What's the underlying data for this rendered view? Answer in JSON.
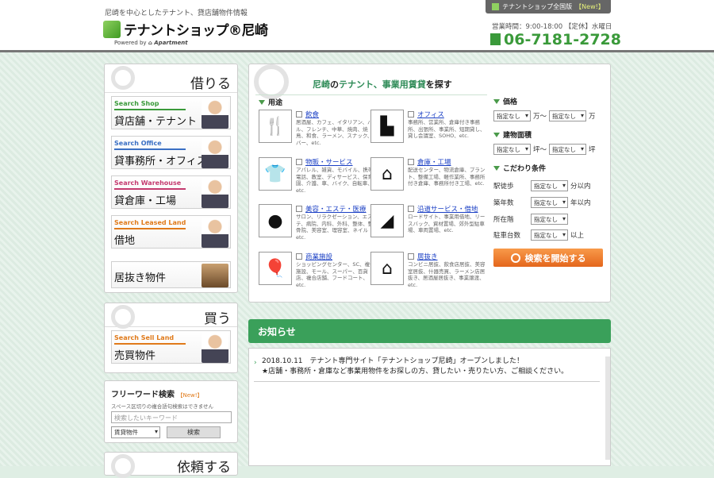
{
  "header": {
    "tagline": "尼崎を中心としたテナント、貸店舗物件情報",
    "logo": "テナントショップ®尼崎",
    "powered": "Powered by",
    "all_stores_label": "テナントショップ全国版",
    "all_stores_badge": "【New!】",
    "hours": "営業時間：9:00-18:00 【定休】水曜日",
    "phone": "06-7181-2728",
    "colors": {
      "green": "#3a9a3a",
      "border": "#777777"
    }
  },
  "rent": {
    "heading": "借りる",
    "items": [
      {
        "en": "Search Shop",
        "jp": "貸店舗・テナント"
      },
      {
        "en": "Search Office",
        "jp": "貸事務所・オフィス"
      },
      {
        "en": "Search Warehouse",
        "jp": "貸倉庫・工場"
      },
      {
        "en": "Search Leased Land",
        "jp": "借地"
      }
    ],
    "extra": "居抜き物件"
  },
  "buy": {
    "heading": "買う",
    "items": [
      {
        "en": "Search Sell Land",
        "jp": "売買物件"
      }
    ]
  },
  "free_word": {
    "title": "フリーワード検索",
    "badge": "【New!】",
    "note": "スペース区切りの複合語句検索はできません",
    "placeholder": "検索したいキーワード",
    "select_value": "賃貸物件",
    "button": "検索"
  },
  "bottom_heading": "依頼する",
  "search": {
    "title_prefix": "尼崎",
    "title_mid": "の",
    "title_rest": "テナント、事業用賃貸",
    "title_suffix": "を探す",
    "usage_label": "用途",
    "categories": [
      {
        "name": "飲食",
        "desc": "居酒屋、カフェ、イタリアン、バル、フレンチ、中華、焼肉、焼鳥、和食、ラーメン、スナック、バー、etc.",
        "icon": "fork-knife-icon"
      },
      {
        "name": "オフィス",
        "desc": "事務所、営業所、倉庫付き事務所、出張所、事業所、短期貸し、貸し会議室、SOHO、etc.",
        "icon": "desk-icon"
      },
      {
        "name": "物販・サービス",
        "desc": "アパレル、雑貨、モバイル、携帯電話、教室、ディサービス、保育園、介護、車、バイク、自転車、etc.",
        "icon": "tshirt-icon"
      },
      {
        "name": "倉庫・工場",
        "desc": "配送センター、物流倉庫、プラント、整備工場、軽作業所、事務所付き倉庫、事務所付き工場、etc.",
        "icon": "factory-icon"
      },
      {
        "name": "美容・エステ・医療",
        "desc": "サロン、リラクゼーション、エステ、病院、内科、外科、整体、整骨院、美容室、理容室、ネイル etc.",
        "icon": "person-icon"
      },
      {
        "name": "沿道サービス・借地",
        "desc": "ロードサイト、事業用借地、リースバック、資材置場、郊外型駐車場、車両置場、etc.",
        "icon": "roadside-icon"
      },
      {
        "name": "商業施設",
        "desc": "ショッピングセンター、SC、複合施設、モール、スーパー、百貨店、複合店舗、フードコート、etc.",
        "icon": "balloons-icon"
      },
      {
        "name": "居抜き",
        "desc": "コンビニ居抜、飲食店居抜、美容室居抜、什器売買、ラーメン店居抜き、居酒屋居抜き、事業譲渡、etc.",
        "icon": "shop-icon"
      }
    ],
    "price_label": "価格",
    "area_label": "建物面積",
    "options_label": "こだわり条件",
    "unspecified": "指定なし",
    "man": "万",
    "tilde_man": "万〜",
    "tsubo": "坪",
    "tilde_tsubo": "坪〜",
    "walk_label": "駅徒歩",
    "walk_unit": "分以内",
    "age_label": "築年数",
    "age_unit": "年以内",
    "floor_label": "所在階",
    "parking_label": "駐車台数",
    "parking_unit": "以上",
    "search_button": "検索を開始する"
  },
  "news": {
    "heading": "お知らせ",
    "line1": "2018.10.11　テナント専門サイト「テナントショップ尼崎」オープンしました！",
    "line2": "★店舗・事務所・倉庫など事業用物件をお探しの方、貸したい・売りたい方、ご相談ください。"
  }
}
